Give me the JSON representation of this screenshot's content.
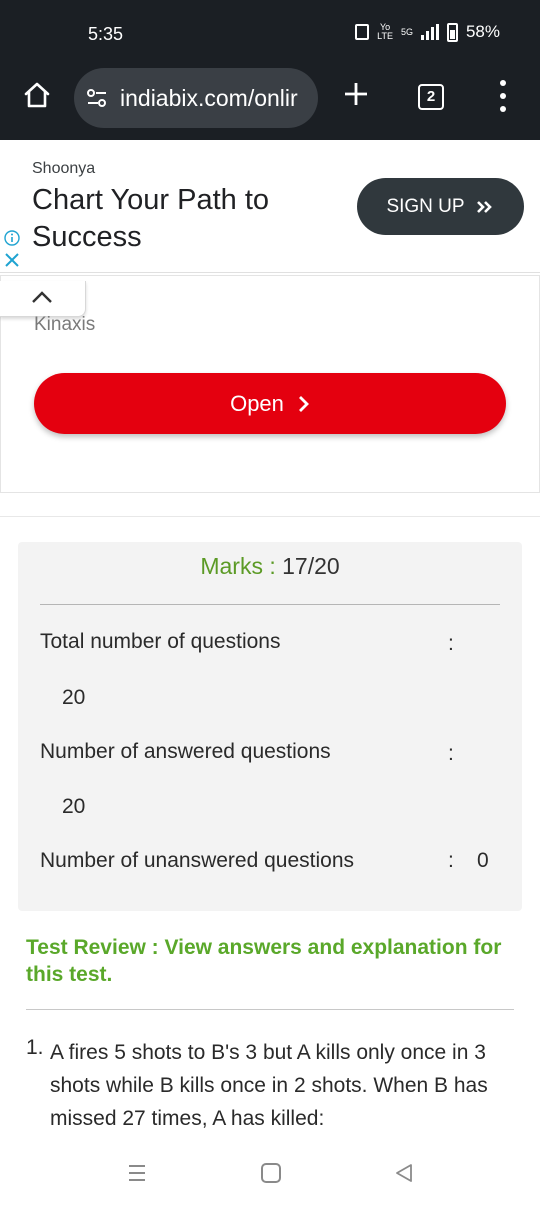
{
  "status_bar": {
    "time": "5:35",
    "volte_top": "Yo",
    "volte_bottom": "LTE",
    "network": "5G",
    "battery": "58%"
  },
  "browser": {
    "url": "indiabix.com/onlir",
    "tab_count": "2",
    "icons": [
      "home-icon",
      "tune-icon",
      "plus-icon",
      "tabs-icon",
      "menu-icon"
    ]
  },
  "ad_banner": {
    "brand": "Shoonya",
    "headline": "Chart Your Path to Success",
    "cta": "SIGN UP",
    "cta_color": "#30383d"
  },
  "ad_panel": {
    "brand": "Kinaxis",
    "cta": "Open",
    "cta_color": "#e4000f"
  },
  "result": {
    "marks_label": "Marks :",
    "marks_value": "17/20",
    "rows": [
      {
        "label": "Total number of questions",
        "colon": ":",
        "value": "20"
      },
      {
        "label": "Number of answered questions",
        "colon": ":",
        "value": "20"
      },
      {
        "label": "Number of unanswered questions",
        "colon": ":",
        "value": "0"
      }
    ],
    "accent_color": "#5b9a25"
  },
  "review": {
    "text": "Test Review : View answers and explanation for this test."
  },
  "question": {
    "number": "1.",
    "text": "A fires 5 shots to B's 3 but A kills only once in 3 shots while B kills once in 2 shots. When B has missed 27 times, A has killed:"
  },
  "nav_bar": {
    "icons": [
      "recent-apps-icon",
      "home-nav-icon",
      "back-icon"
    ]
  }
}
